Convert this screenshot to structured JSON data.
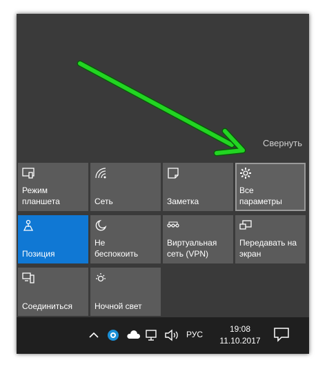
{
  "action_center": {
    "collapse_label": "Свернуть",
    "tiles": [
      {
        "label": "Режим\nпланшета",
        "icon": "tablet-mode-icon"
      },
      {
        "label": "Сеть",
        "icon": "network-icon"
      },
      {
        "label": "Заметка",
        "icon": "note-icon"
      },
      {
        "label": "Все\nпараметры",
        "icon": "gear-icon"
      },
      {
        "label": "Позиция",
        "icon": "location-icon"
      },
      {
        "label": "Не\nбеспокоить",
        "icon": "moon-icon"
      },
      {
        "label": "Виртуальная\nсеть (VPN)",
        "icon": "vpn-icon"
      },
      {
        "label": "Передавать на\nэкран",
        "icon": "project-icon"
      },
      {
        "label": "Соединиться",
        "icon": "connect-icon"
      },
      {
        "label": "Ночной свет",
        "icon": "night-light-icon"
      }
    ]
  },
  "taskbar": {
    "language": "РУС",
    "time": "19:08",
    "date": "11.10.2017"
  },
  "colors": {
    "tile": "#5b5b5b",
    "tile_active": "#1078d4",
    "arrow": "#22d522",
    "taskbar": "#1f1f1f"
  }
}
